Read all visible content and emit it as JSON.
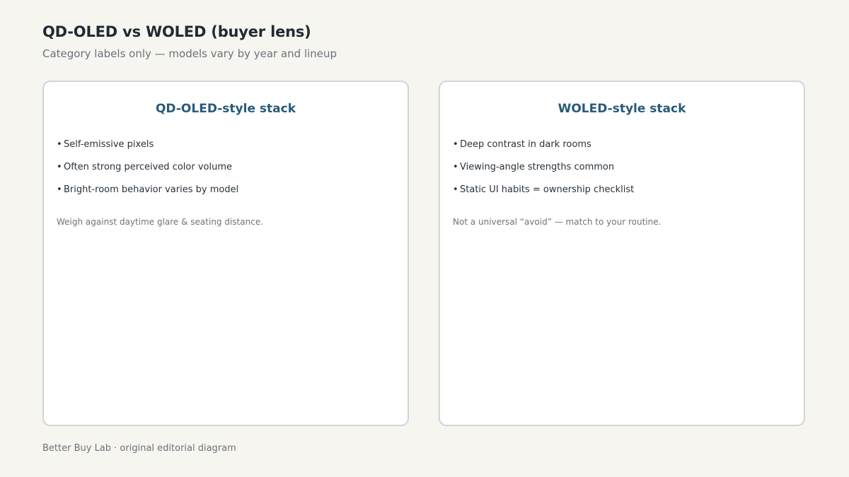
{
  "header": {
    "title": "QD-OLED vs WOLED (buyer lens)",
    "subtitle": "Category labels only — models vary by year and lineup"
  },
  "panels": [
    {
      "heading": "QD-OLED-style stack",
      "bullets": [
        "Self-emissive pixels",
        "Often strong perceived color volume",
        "Bright-room behavior varies by model"
      ],
      "note": "Weigh against daytime glare & seating distance."
    },
    {
      "heading": "WOLED-style stack",
      "bullets": [
        "Deep contrast in dark rooms",
        "Viewing-angle strengths common",
        "Static UI habits = ownership checklist"
      ],
      "note": "Not a universal “avoid” — match to your routine."
    }
  ],
  "bullet_marker": "•",
  "footer": {
    "text": "Better Buy Lab · original editorial diagram"
  },
  "colors": {
    "background": "#f6f5f0",
    "heading_accent": "#285a7a",
    "panel_border": "#d1d5d7"
  }
}
